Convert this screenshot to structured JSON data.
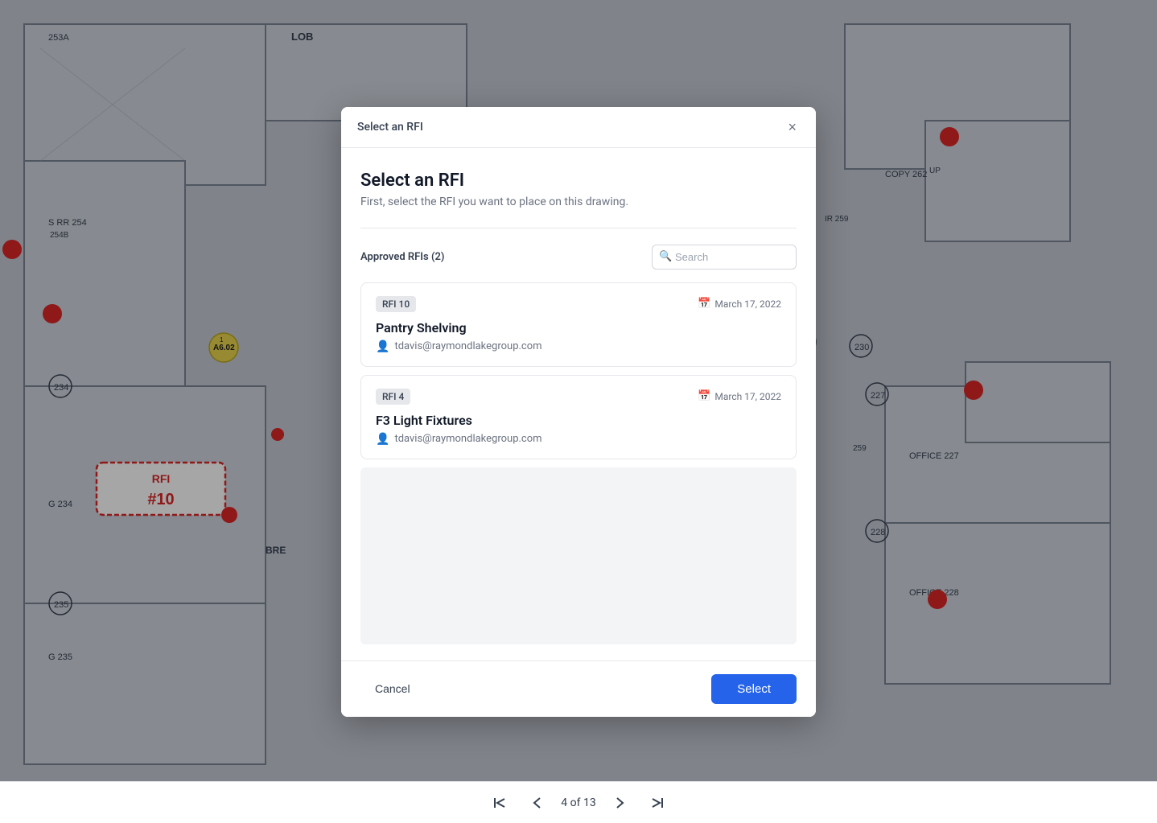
{
  "modal": {
    "header_title": "Select an RFI",
    "close_label": "×",
    "title": "Select an RFI",
    "subtitle": "First, select the RFI you want to place on this drawing.",
    "filter_label": "Approved RFIs (2)",
    "search_placeholder": "Search",
    "rfi_items": [
      {
        "badge": "RFI 10",
        "date": "March 17, 2022",
        "name": "Pantry Shelving",
        "author": "tdavis@raymondlakegroup.com"
      },
      {
        "badge": "RFI 4",
        "date": "March 17, 2022",
        "name": "F3 Light Fixtures",
        "author": "tdavis@raymondlakegroup.com"
      }
    ],
    "cancel_label": "Cancel",
    "select_label": "Select"
  },
  "navigation": {
    "page_indicator": "4 of 13"
  }
}
